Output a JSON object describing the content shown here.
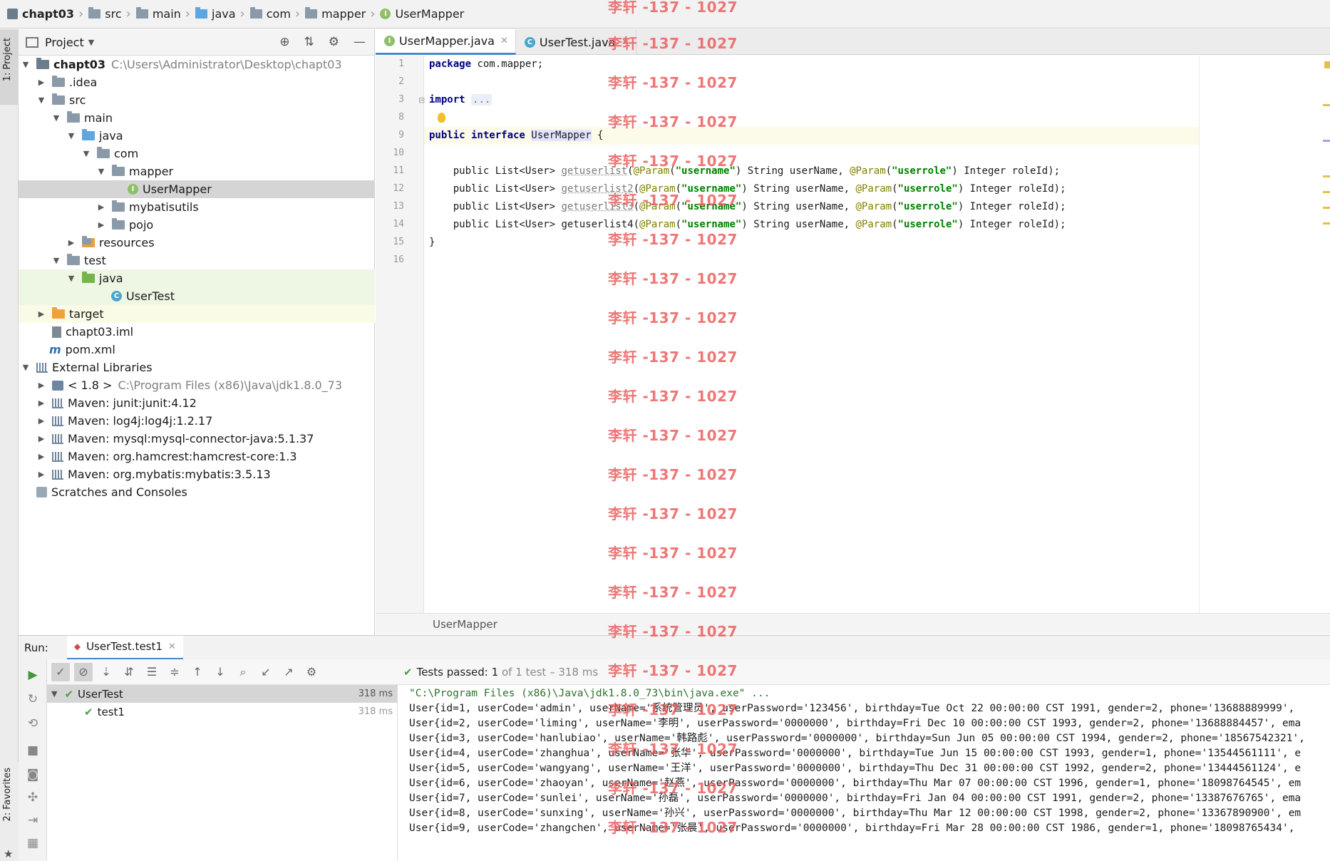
{
  "breadcrumb": [
    "chapt03",
    "src",
    "main",
    "java",
    "com",
    "mapper",
    "UserMapper"
  ],
  "left_strip": {
    "project_tab": "1: Project",
    "favorites_tab": "2: Favorites"
  },
  "project_panel": {
    "title": "Project",
    "root": {
      "name": "chapt03",
      "path": "C:\\Users\\Administrator\\Desktop\\chapt03"
    },
    "nodes": [
      ".idea",
      "src",
      "main",
      "java",
      "com",
      "mapper",
      "UserMapper",
      "mybatisutils",
      "pojo",
      "resources",
      "test",
      "java",
      "UserTest",
      "target",
      "chapt03.iml",
      "pom.xml"
    ],
    "external_libraries": {
      "label": "External Libraries",
      "jdk": {
        "name": "< 1.8 >",
        "path": "C:\\Program Files (x86)\\Java\\jdk1.8.0_73"
      },
      "maven": [
        "Maven: junit:junit:4.12",
        "Maven: log4j:log4j:1.2.17",
        "Maven: mysql:mysql-connector-java:5.1.37",
        "Maven: org.hamcrest:hamcrest-core:1.3",
        "Maven: org.mybatis:mybatis:3.5.13"
      ]
    },
    "scratches": "Scratches and Consoles"
  },
  "editor": {
    "tabs": [
      "UserMapper.java",
      "UserTest.java"
    ],
    "line_numbers": [
      "1",
      "2",
      "3",
      "8",
      "9",
      "10",
      "11",
      "12",
      "13",
      "14",
      "15",
      "16"
    ],
    "code": {
      "l1_kw": "package",
      "l1_rest": " com.mapper;",
      "l3_kw": "import",
      "l3_fold": "...",
      "l9_kw": "public interface",
      "l9_name": "UserMapper",
      "l9_rest": " {",
      "method_prefix": "    public List<User> ",
      "method_names": [
        "getuserlist",
        "getuserlist2",
        "getuserlist3",
        "getuserlist4"
      ],
      "open_paren": "(",
      "param_ann": "@Param",
      "param_open": "(",
      "param1_str": "\"username\"",
      "param1_rest": ") String userName, ",
      "param2_str": "\"userrole\"",
      "param2_rest": ") Integer roleId);",
      "closing_brace": "}"
    },
    "footer": "UserMapper"
  },
  "run": {
    "label": "Run:",
    "tab": "UserTest.test1",
    "status_prefix": "Tests passed:",
    "status_count": "1",
    "status_suffix": "of 1 test – 318 ms",
    "tree": [
      {
        "name": "UserTest",
        "time": "318 ms"
      },
      {
        "name": "test1",
        "time": "318 ms"
      }
    ],
    "console": [
      "\"C:\\Program Files (x86)\\Java\\jdk1.8.0_73\\bin\\java.exe\" ...",
      "User{id=1, userCode='admin', userName='系统管理员', userPassword='123456', birthday=Tue Oct 22 00:00:00 CST 1991, gender=2, phone='13688889999', ",
      "User{id=2, userCode='liming', userName='李明', userPassword='0000000', birthday=Fri Dec 10 00:00:00 CST 1993, gender=2, phone='13688884457', ema",
      "User{id=3, userCode='hanlubiao', userName='韩路彪', userPassword='0000000', birthday=Sun Jun 05 00:00:00 CST 1994, gender=2, phone='18567542321', ",
      "User{id=4, userCode='zhanghua', userName='张华', userPassword='0000000', birthday=Tue Jun 15 00:00:00 CST 1993, gender=1, phone='13544561111', e",
      "User{id=5, userCode='wangyang', userName='王洋', userPassword='0000000', birthday=Thu Dec 31 00:00:00 CST 1992, gender=2, phone='13444561124', e",
      "User{id=6, userCode='zhaoyan', userName='赵燕', userPassword='0000000', birthday=Thu Mar 07 00:00:00 CST 1996, gender=1, phone='18098764545', em",
      "User{id=7, userCode='sunlei', userName='孙磊', userPassword='0000000', birthday=Fri Jan 04 00:00:00 CST 1991, gender=2, phone='13387676765', ema",
      "User{id=8, userCode='sunxing', userName='孙兴', userPassword='0000000', birthday=Thu Mar 12 00:00:00 CST 1998, gender=2, phone='13367890900', em",
      "User{id=9, userCode='zhangchen', userName='张晨', userPassword='0000000', birthday=Fri Mar 28 00:00:00 CST 1986, gender=1, phone='18098765434', "
    ]
  },
  "watermark": "李轩 -137 - 1027",
  "colors": {
    "keyword": "#000080",
    "annotation": "#808000",
    "string": "#008000",
    "pass_green": "#4aa24a",
    "watermark": "#e95959",
    "tab_accent": "#4a88c7"
  }
}
